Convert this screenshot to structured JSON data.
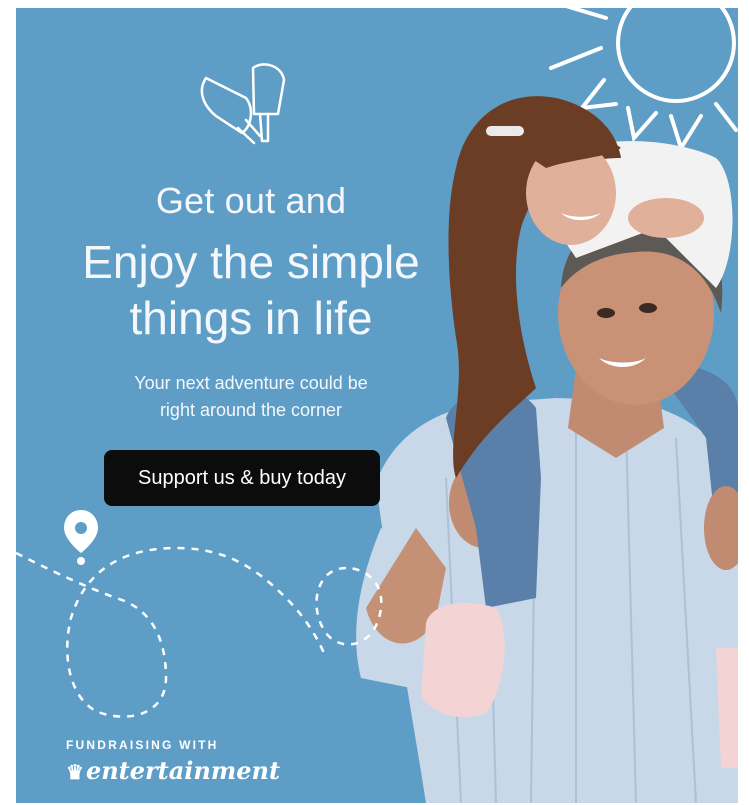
{
  "ad": {
    "headline_line1": "Get out and",
    "headline_line2": "Enjoy the simple",
    "headline_line3": "things in life",
    "subtitle_line1": "Your next adventure could be",
    "subtitle_line2": "right around the corner",
    "cta_label": "Support us & buy today",
    "branding_caption": "FUNDRAISING WITH",
    "branding_logo_text": "entertainment",
    "colors": {
      "background": "#5e9ec6",
      "cta": "#0c0c0c",
      "text": "#ffffff"
    },
    "icons": [
      "popsicle-icon",
      "sun-icon",
      "map-pin-icon",
      "dashed-path",
      "crown-icon"
    ]
  }
}
